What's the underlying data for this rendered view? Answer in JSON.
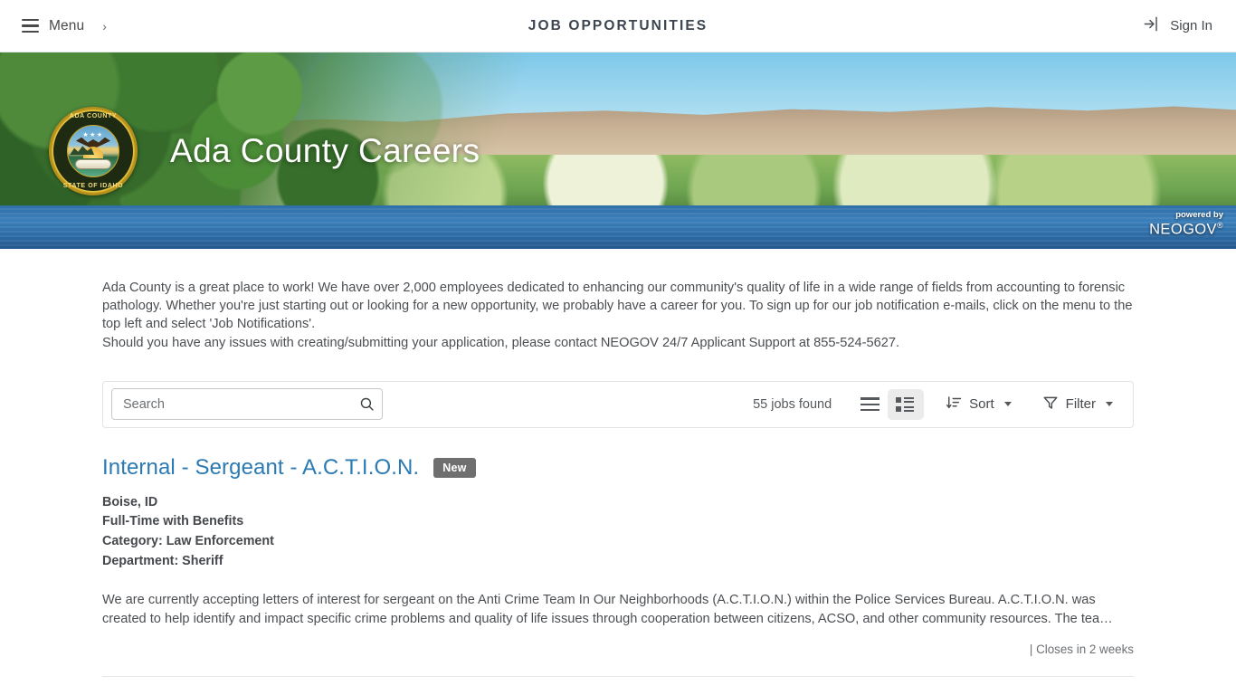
{
  "topbar": {
    "menu_label": "Menu",
    "menu_icon": "hamburger-icon",
    "chevron": "›",
    "page_title": "JOB OPPORTUNITIES",
    "signin_label": "Sign In",
    "signin_icon": "sign-in-icon"
  },
  "hero": {
    "title": "Ada County Careers",
    "seal": {
      "top_text": "ADA COUNTY",
      "bottom_text": "STATE OF IDAHO",
      "stars": "★★★"
    },
    "neogov": {
      "powered_by": "powered by",
      "brand": "NEOGOV",
      "registered": "®"
    }
  },
  "intro": {
    "paragraph1": "Ada County is a great place to work!  We have over 2,000 employees dedicated to enhancing our community's quality of life in a wide range of fields from accounting to forensic pathology.  Whether you're just starting out or looking for a new opportunity, we probably have a career for you.  To sign up for our job notification e-mails, click on the menu to the top left and select 'Job Notifications'.",
    "paragraph2": "Should you have any issues with creating/submitting your application, please contact NEOGOV 24/7 Applicant Support at 855-524-5627."
  },
  "toolbar": {
    "search_placeholder": "Search",
    "search_value": "",
    "search_icon": "search-icon",
    "results_count": "55 jobs found",
    "list_view_icon": "list-view-icon",
    "grid_view_icon": "detail-view-icon",
    "active_view": "detail",
    "sort_label": "Sort",
    "sort_icon": "sort-descending-icon",
    "filter_label": "Filter",
    "filter_icon": "funnel-icon"
  },
  "jobs": [
    {
      "title": "Internal - Sergeant - A.C.T.I.O.N.",
      "badge": "New",
      "location": "Boise, ID",
      "employment_type": "Full-Time with Benefits",
      "category": "Category: Law Enforcement",
      "department": "Department: Sheriff",
      "description": "We are currently accepting letters of interest for sergeant on the Anti Crime Team In Our Neighborhoods (A.C.T.I.O.N.) within the Police Services Bureau.   A.C.T.I.O.N. was created to help identify and impact specific crime problems and quality of life issues through cooperation between citizens, ACSO, and other community resources.  The tea…",
      "closes": "| Closes in 2 weeks"
    }
  ],
  "colors": {
    "link_blue": "#2a7ab3",
    "badge_gray": "#6f6f6f",
    "text_dark": "#45484c",
    "border_gray": "#e3e3e3"
  }
}
